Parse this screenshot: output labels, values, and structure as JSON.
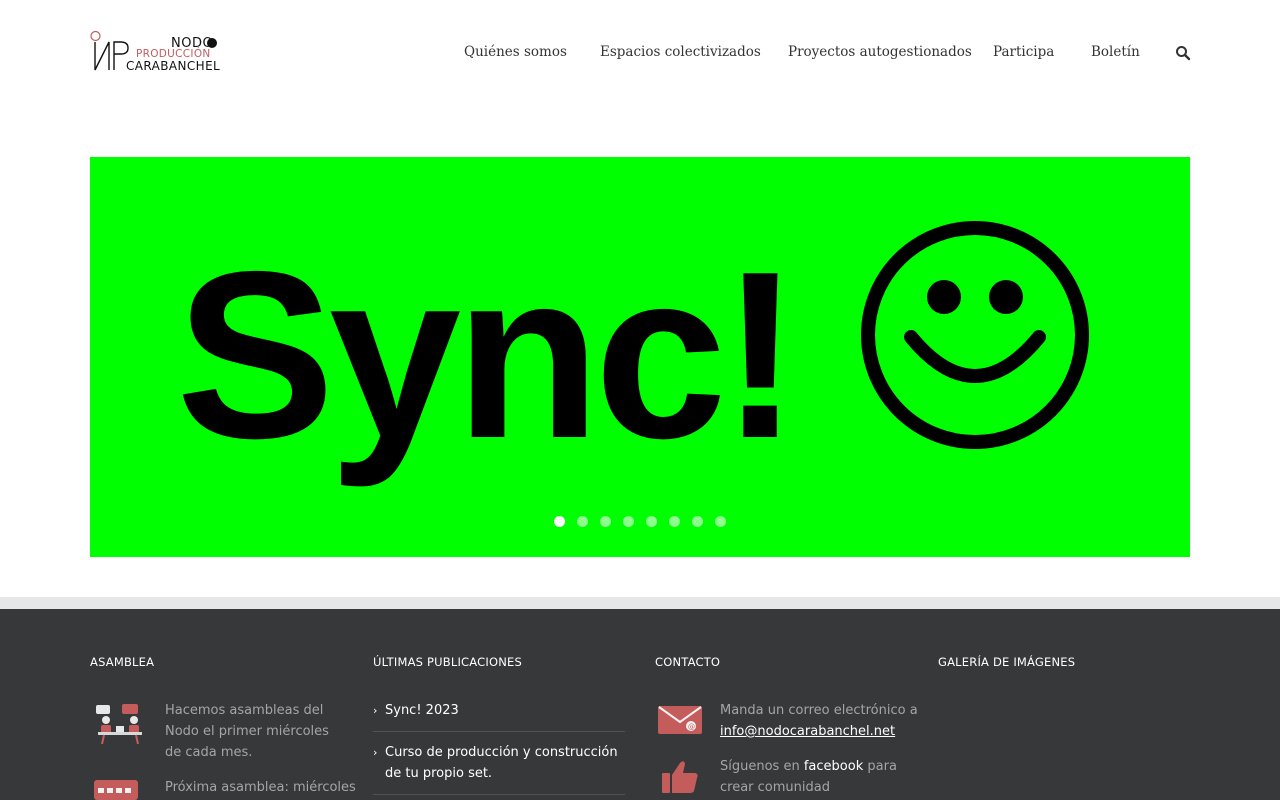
{
  "header": {
    "logo": {
      "line1": "NODO",
      "line2": "PRODUCCIÓN",
      "line3": "CARABANCHEL"
    },
    "nav": [
      {
        "label": "Quiénes somos"
      },
      {
        "label": "Espacios colectivizados"
      },
      {
        "label": "Proyectos autogestionados"
      },
      {
        "label": "Participa"
      },
      {
        "label": "Boletín"
      }
    ],
    "search_icon": "search-icon"
  },
  "slider": {
    "text": "Sync!",
    "emoji_icon": "smiley-face-icon",
    "background": "#00ff00",
    "slide_count": 8,
    "active_index": 0
  },
  "footer": {
    "asamblea": {
      "title": "ASAMBLEA",
      "text1": "Hacemos asambleas del Nodo el primer miércoles de cada mes.",
      "text2": "Próxima asamblea: miércoles",
      "icon1": "meeting-icon",
      "icon2": "calendar-icon"
    },
    "publicaciones": {
      "title": "ÚLTIMAS PUBLICACIONES",
      "items": [
        {
          "label": "Sync! 2023"
        },
        {
          "label": "Curso de producción y construcción de tu propio set."
        }
      ]
    },
    "contacto": {
      "title": "CONTACTO",
      "mail_prefix": "Manda un correo electrónico a",
      "mail_link": "info@nodocarabanchel.net",
      "fb_prefix": "Síguenos en",
      "fb_link": "facebook",
      "fb_suffix": "para crear comunidad",
      "mail_icon": "envelope-icon",
      "like_icon": "thumbs-up-icon"
    },
    "galeria": {
      "title": "GALERÍA DE IMÁGENES"
    }
  },
  "colors": {
    "accent": "#c45c5c",
    "footer_bg": "#363839",
    "slider_bg": "#00ff00"
  }
}
